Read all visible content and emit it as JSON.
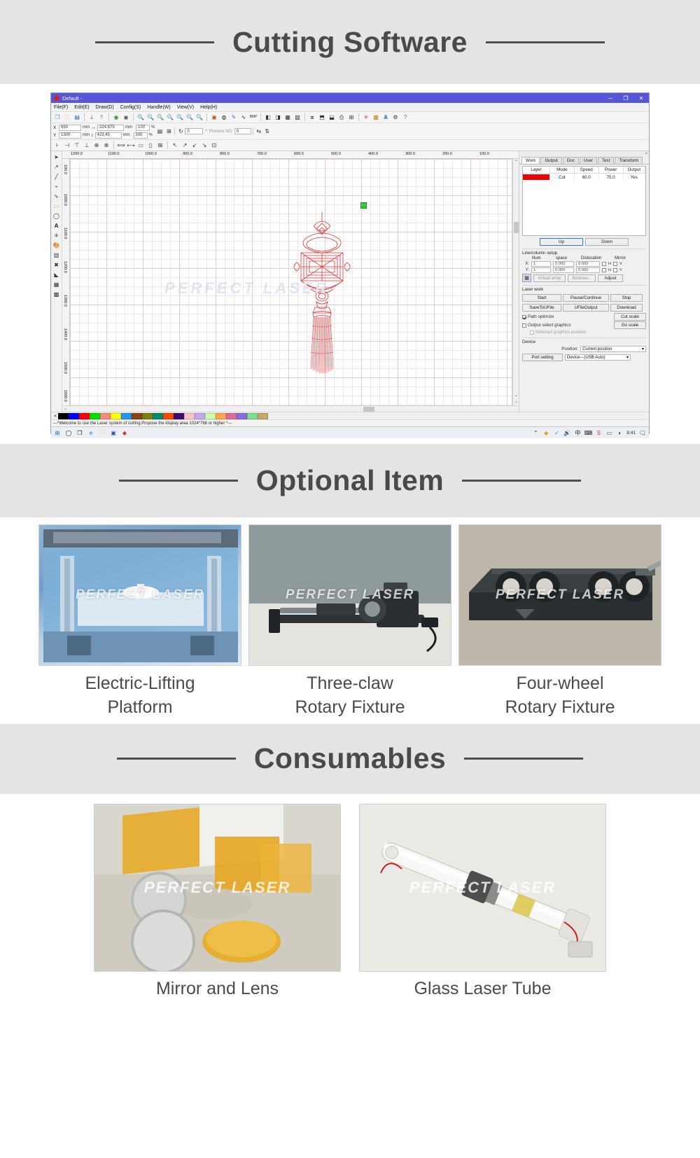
{
  "sections": [
    {
      "title": "Cutting Software"
    },
    {
      "title": "Optional Item"
    },
    {
      "title": "Consumables"
    }
  ],
  "software": {
    "window_title": "Default -",
    "window_buttons": {
      "minimize": "─",
      "maximize": "❐",
      "close": "✕"
    },
    "menu": [
      "File(F)",
      "Edit(E)",
      "Draw(D)",
      "Config(S)",
      "Handle(W)",
      "View(V)",
      "Help(H)"
    ],
    "coords": {
      "x_label": "X",
      "x_value": "650",
      "x_unit": "mm",
      "y_label": "Y",
      "y_value": "1300",
      "y_unit": "mm",
      "w_value": "224.875",
      "w_unit": "mm",
      "h_value": "423.45",
      "h_unit": "mm",
      "scale_x": "100",
      "scale_y": "100",
      "percent": "%",
      "angle_value": "0",
      "angle_unit": "°",
      "process_no_label": "Process NO:",
      "process_no_value": "0"
    },
    "ruler_h": [
      "1200.0",
      "1100.0",
      "1000.0",
      "900.0",
      "800.0",
      "700.0",
      "600.0",
      "500.0",
      "400.0",
      "300.0",
      "200.0",
      "100.0"
    ],
    "ruler_v": [
      "100.0",
      "1000.0",
      "1100.0",
      "1200.0",
      "1300.0",
      "1400.0",
      "1500.0",
      "1600.0"
    ],
    "watermark": "PERFECT LASER",
    "panel": {
      "tabs": [
        "Work",
        "Output",
        "Doc",
        "User",
        "Test",
        "Transform"
      ],
      "active_tab": "Work",
      "layer_table": {
        "headers": [
          "Layer",
          "Mode",
          "Speed",
          "Power",
          "Output"
        ],
        "rows": [
          {
            "color": "#ee0000",
            "mode": "Cut",
            "speed": "60.0",
            "power": "75.0",
            "output": "Yes"
          }
        ]
      },
      "up_button": "Up",
      "down_button": "Down",
      "line_column_setup": {
        "title": "Line/column setup",
        "headers": [
          "Num",
          "space",
          "Dislocation",
          "Mirror"
        ],
        "rows": [
          {
            "axis": "X:",
            "num": "1",
            "space": "0.000",
            "dislocation": "0.000",
            "mirror_h": "H",
            "mirror_v": "V"
          },
          {
            "axis": "Y:",
            "num": "1",
            "space": "0.000",
            "dislocation": "0.000",
            "mirror_h": "H",
            "mirror_v": "V"
          }
        ],
        "virtual_array": "Virtual array",
        "bestrew": "Bestrew...",
        "adjust": "Adjust"
      },
      "laser_work": {
        "title": "Laser work",
        "start": "Start",
        "pause_continue": "Pause/Continue",
        "stop": "Stop",
        "save_to_ufile": "SaveToUFile",
        "ufile_output": "UFileOutput",
        "download": "Download",
        "path_optimize": "Path optimize",
        "path_optimize_checked": true,
        "output_select_graphics": "Output select graphics",
        "output_select_checked": false,
        "selected_graphics_position": "Selected graphics position",
        "selected_graphics_checked": false,
        "cut_scale": "Cut scale",
        "go_scale": "Go scale"
      },
      "device": {
        "title": "Device",
        "position_label": "Position:",
        "position_value": "Current position",
        "port_setting": "Port setting",
        "device_value": "Device---(USB:Auto)"
      }
    },
    "palette": [
      "#000000",
      "#0000ff",
      "#ff0000",
      "#00e000",
      "#f58a7a",
      "#ffff00",
      "#2196f3",
      "#8b4513",
      "#808000",
      "#008b6e",
      "#ff4500",
      "#3b0a6e",
      "#ffc0cb",
      "#c3aaf0",
      "#ccffaa",
      "#ffa64d",
      "#e06a9a",
      "#8a6ae0",
      "#7ee08a",
      "#c4a96a"
    ],
    "status_text": "---*Welcome to use the Laser system of cutting,Propose the display area 1024*768 or higher *---",
    "taskbar": {
      "clock": "8:41"
    }
  },
  "optional_items": [
    {
      "name": "Electric-Lifting Platform",
      "line1": "Electric-Lifting",
      "line2": "Platform",
      "watermark": "PERFECT LASER",
      "style": "img-lift"
    },
    {
      "name": "Three-claw Rotary Fixture",
      "line1": "Three-claw",
      "line2": "Rotary Fixture",
      "watermark": "PERFECT LASER",
      "style": "img-three"
    },
    {
      "name": "Four-wheel Rotary Fixture",
      "line1": "Four-wheel",
      "line2": "Rotary Fixture",
      "watermark": "PERFECT LASER",
      "style": "img-four"
    }
  ],
  "consumables": [
    {
      "name": "Mirror and Lens",
      "watermark": "PERFECT LASER",
      "style": "img-mirror"
    },
    {
      "name": "Glass Laser Tube",
      "watermark": "PERFECT LASER",
      "style": "img-tube"
    }
  ],
  "colors": {
    "banner_bg": "#e4e4e4",
    "heading": "#4a4a4a",
    "titlebar": "#5755d9",
    "layer_red": "#ee0000"
  }
}
